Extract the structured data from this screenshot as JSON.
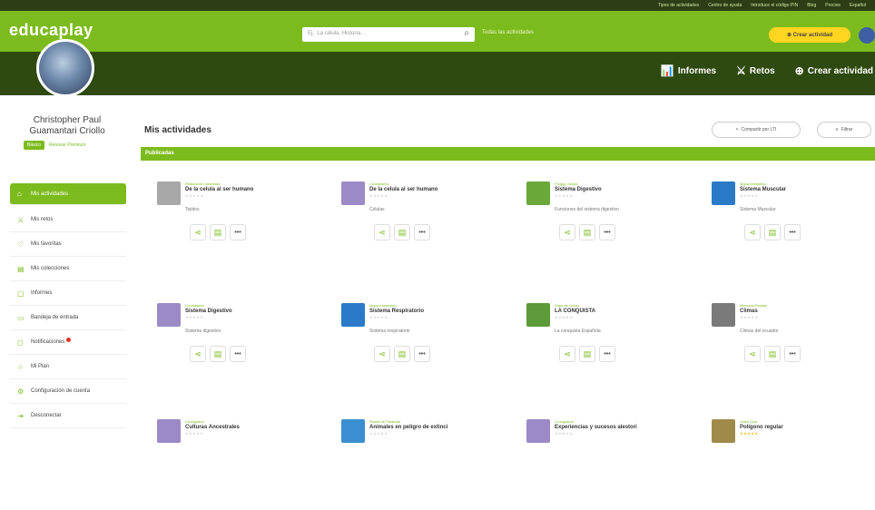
{
  "topstrip": {
    "links": [
      "Tipos de actividades",
      "Centro de ayuda",
      "Introduce el código PIN",
      "Blog",
      "Precios",
      "Español"
    ]
  },
  "header": {
    "logo": "educaplay",
    "search_placeholder": "Ej.: La célula, Historia…",
    "search_button": "Todas las actividades",
    "create_button": "Crear actividad"
  },
  "banner": {
    "nav": [
      {
        "icon": "chart-icon",
        "label": "Informes"
      },
      {
        "icon": "challenge-icon",
        "label": "Retos"
      },
      {
        "icon": "plus-circle-icon",
        "label": "Crear actividad"
      }
    ]
  },
  "profile": {
    "name": "Christopher Paul\nGuamantari Criollo",
    "plan_badge": "Básico",
    "plan_link": "Renovar Premium"
  },
  "sidebar": {
    "items": [
      {
        "icon": "activities-icon",
        "label": "Mis actividades",
        "active": true
      },
      {
        "icon": "challenge-icon",
        "label": "Mis retos"
      },
      {
        "icon": "heart-icon",
        "label": "Mis favoritas"
      },
      {
        "icon": "collection-icon",
        "label": "Mis colecciones"
      },
      {
        "icon": "report-icon",
        "label": "Informes"
      },
      {
        "icon": "inbox-icon",
        "label": "Bandeja de entrada"
      },
      {
        "icon": "bell-icon",
        "label": "Notificaciones"
      },
      {
        "icon": "star-icon",
        "label": "Mi Plan"
      },
      {
        "icon": "gear-icon",
        "label": "Configuración de cuenta"
      },
      {
        "icon": "logout-icon",
        "label": "Desconectar"
      }
    ]
  },
  "main": {
    "title": "Mis actividades",
    "share_button": "Compartir por LTI",
    "filter_button": "Filtrar",
    "section_label": "Publicadas",
    "cards": [
      {
        "category": "Relacionar Columnas",
        "title": "De la celula al ser humano",
        "stars": "★★★★★",
        "desc": "Tejidos",
        "thumb_color": "#a8a8a8"
      },
      {
        "category": "Crucigrama",
        "title": "De la celula al ser humano",
        "stars": "★★★★★",
        "desc": "Células",
        "thumb_color": "#9b8ac6"
      },
      {
        "category": "Froggy Jumps",
        "title": "Sistema Digestivo",
        "stars": "★★★★★",
        "desc": "Funciones del sistema digestivo",
        "thumb_color": "#6aa83a"
      },
      {
        "category": "Mapa Interactivo",
        "title": "Sistema Muscular",
        "stars": "★★★★★",
        "desc": "Sistema Muscular",
        "thumb_color": "#2a7ac8"
      },
      {
        "category": "Crucigrama",
        "title": "Sistema Digestivo",
        "stars": "★★★★★",
        "desc": "Sistema digestivo",
        "thumb_color": "#9b8ac6"
      },
      {
        "category": "Mapa Interactivo",
        "title": "Sistema Respiratorio",
        "stars": "★★★★★",
        "desc": "Sistema respiratorio",
        "thumb_color": "#2a7ac8"
      },
      {
        "category": "Sopa de Letras",
        "title": "LA CONQUISTA",
        "stars": "★★★★★",
        "desc": "La conquista Española",
        "thumb_color": "#5c9a3a"
      },
      {
        "category": "Memoria Parejas",
        "title": "Climas",
        "stars": "★★★★★",
        "desc": "Climas del ecuador",
        "thumb_color": "#7a7a7a"
      },
      {
        "category": "Crucigrama",
        "title": "Culturas Ancestrales",
        "stars": "★★★★★",
        "desc": "",
        "thumb_color": "#9b8ac6"
      },
      {
        "category": "Ruleta de Palabras",
        "title": "Animales en peligro de extinci",
        "stars": "★★★★★",
        "desc": "",
        "thumb_color": "#3b8fd0"
      },
      {
        "category": "Crucigrama",
        "title": "Experiencias y sucesos alestori",
        "stars": "★★★★★",
        "desc": "",
        "thumb_color": "#9b8ac6"
      },
      {
        "category": "Video Quiz",
        "title": "Polígono regular",
        "stars": "★★★★★",
        "desc": "",
        "thumb_color": "#a08a4a",
        "stars_yellow": true
      }
    ]
  },
  "colors": {
    "brand_green": "#7cbb1e",
    "banner_dark": "#2f4a10",
    "accent_yellow": "#ffd51f"
  }
}
